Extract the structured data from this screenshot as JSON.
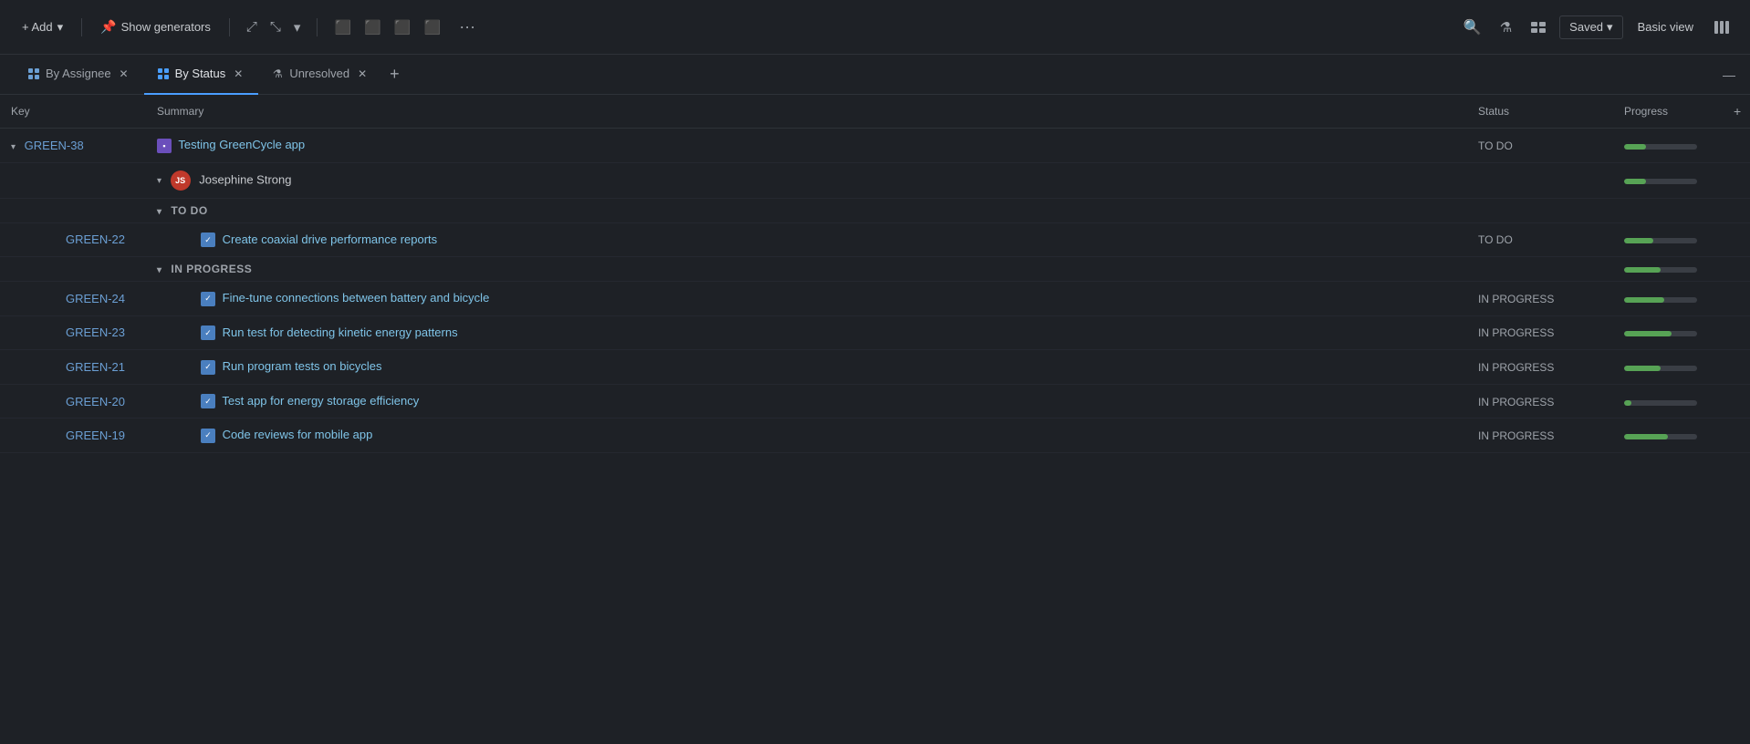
{
  "toolbar": {
    "add_label": "+ Add",
    "show_generators_label": "Show generators",
    "saved_label": "Saved",
    "basic_view_label": "Basic view"
  },
  "tabs": [
    {
      "id": "by-assignee",
      "label": "By Assignee",
      "active": false,
      "closable": true
    },
    {
      "id": "by-status",
      "label": "By Status",
      "active": true,
      "closable": true
    },
    {
      "id": "unresolved",
      "label": "Unresolved",
      "active": false,
      "closable": true,
      "has_filter": true
    }
  ],
  "table": {
    "columns": [
      {
        "id": "key",
        "label": "Key"
      },
      {
        "id": "summary",
        "label": "Summary"
      },
      {
        "id": "status",
        "label": "Status"
      },
      {
        "id": "progress",
        "label": "Progress"
      }
    ],
    "rows": [
      {
        "type": "issue",
        "key": "GREEN-38",
        "summary": "Testing GreenCycle app",
        "status": "TO DO",
        "progress": 30,
        "icon_type": "story",
        "indent": 0
      },
      {
        "type": "assignee",
        "assignee": "Josephine Strong",
        "assignee_initials": "JS",
        "indent": 1,
        "progress": 30
      },
      {
        "type": "group-header",
        "group": "TO DO",
        "indent": 2
      },
      {
        "type": "issue",
        "key": "GREEN-22",
        "summary": "Create coaxial drive performance reports",
        "status": "TO DO",
        "progress": 40,
        "icon_type": "task",
        "indent": 2
      },
      {
        "type": "group-header",
        "group": "IN PROGRESS",
        "indent": 2
      },
      {
        "type": "issue",
        "key": "GREEN-24",
        "summary": "Fine-tune connections between battery and bicycle",
        "status": "IN PROGRESS",
        "progress": 55,
        "icon_type": "task",
        "indent": 2
      },
      {
        "type": "issue",
        "key": "GREEN-23",
        "summary": "Run test for detecting kinetic energy patterns",
        "status": "IN PROGRESS",
        "progress": 65,
        "icon_type": "task",
        "indent": 2
      },
      {
        "type": "issue",
        "key": "GREEN-21",
        "summary": "Run program tests on bicycles",
        "status": "IN PROGRESS",
        "progress": 50,
        "icon_type": "task",
        "indent": 2
      },
      {
        "type": "issue",
        "key": "GREEN-20",
        "summary": "Test app for energy storage efficiency",
        "status": "IN PROGRESS",
        "progress": 10,
        "icon_type": "task",
        "indent": 2
      },
      {
        "type": "issue",
        "key": "GREEN-19",
        "summary": "Code reviews for mobile app",
        "status": "IN PROGRESS",
        "progress": 60,
        "icon_type": "task",
        "indent": 2
      }
    ]
  }
}
